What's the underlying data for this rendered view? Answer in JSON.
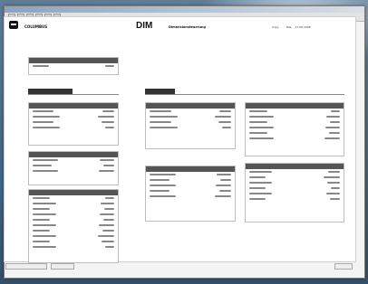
{
  "window": {
    "title": ""
  },
  "header": {
    "brand": "COLUMBUS",
    "brand_suffix": "",
    "module": "DIM",
    "subtitle": "Dimensionsteuerung",
    "right_label": "Copy",
    "right_value": "",
    "right_label2": "Tele",
    "date": "17.09.1998"
  },
  "sections": {
    "left": "",
    "right": ""
  },
  "panels": [
    {
      "title": "",
      "rows": 1
    },
    {
      "title": "",
      "rows": 4
    },
    {
      "title": "",
      "rows": 3
    },
    {
      "title": "",
      "rows": 10
    },
    {
      "title": "",
      "rows": 4
    },
    {
      "title": "",
      "rows": 5
    },
    {
      "title": "",
      "rows": 6
    },
    {
      "title": "",
      "rows": 6
    }
  ],
  "status": {
    "left": "",
    "mid": "",
    "right": ""
  }
}
